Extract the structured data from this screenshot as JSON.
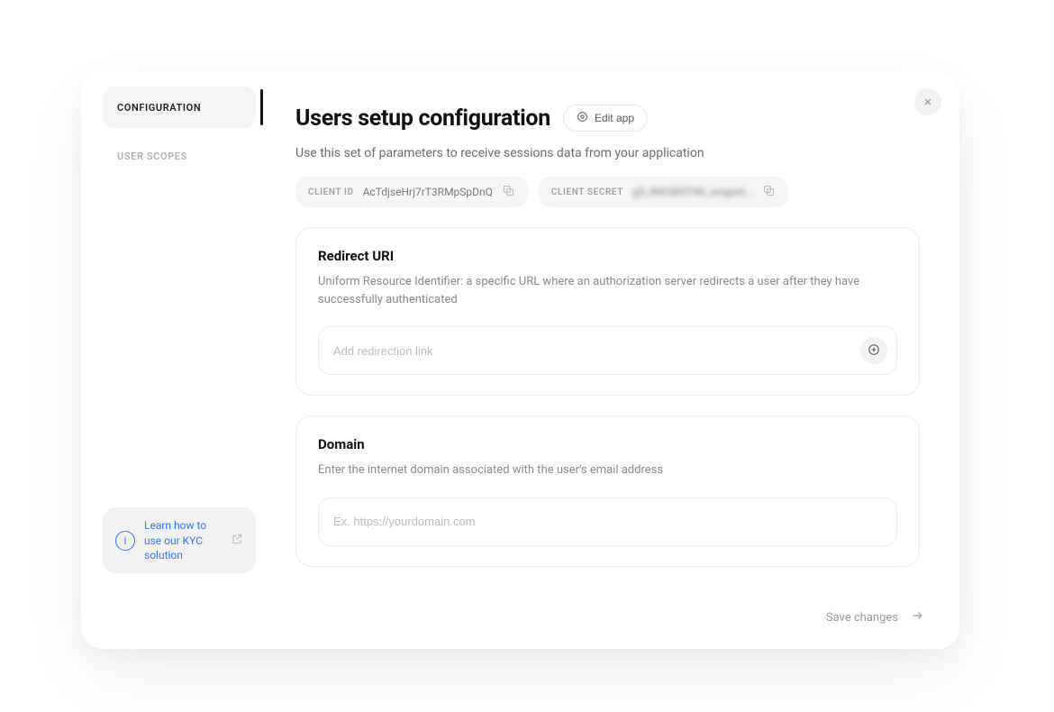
{
  "sidebar": {
    "items": [
      {
        "label": "CONFIGURATION",
        "active": true
      },
      {
        "label": "USER SCOPES",
        "active": false
      }
    ],
    "help": {
      "text": "Learn how to use our KYC solution"
    }
  },
  "header": {
    "title": "Users setup configuration",
    "edit_label": "Edit app",
    "subtitle": "Use this set of parameters to receive sessions data from your application"
  },
  "credentials": {
    "client_id": {
      "label": "CLIENT ID",
      "value": "AcTdjseHrj7rT3RMpSpDnQ"
    },
    "client_secret": {
      "label": "CLIENT SECRET",
      "value": "gS_RtK3B5TWt_wrqjwd..."
    }
  },
  "sections": {
    "redirect": {
      "title": "Redirect URI",
      "desc": "Uniform Resource Identifier: a specific URL where an authorization server redirects a user after they have successfully authenticated",
      "placeholder": "Add redirection link"
    },
    "domain": {
      "title": "Domain",
      "desc": "Enter the internet domain associated with the user's email address",
      "placeholder": "Ex. https://yourdomain.com"
    }
  },
  "footer": {
    "save_label": "Save changes"
  }
}
